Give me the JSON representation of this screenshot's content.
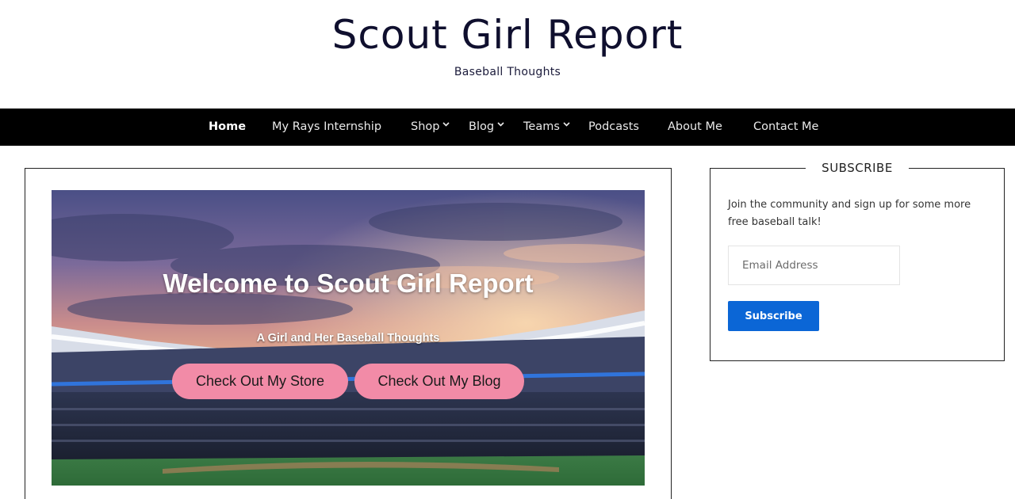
{
  "site": {
    "title": "Scout Girl Report",
    "tagline": "Baseball Thoughts"
  },
  "nav": {
    "items": [
      {
        "label": "Home",
        "active": true,
        "dropdown": false
      },
      {
        "label": "My Rays Internship",
        "active": false,
        "dropdown": false
      },
      {
        "label": "Shop",
        "active": false,
        "dropdown": true
      },
      {
        "label": "Blog",
        "active": false,
        "dropdown": true
      },
      {
        "label": "Teams",
        "active": false,
        "dropdown": true
      },
      {
        "label": "Podcasts",
        "active": false,
        "dropdown": false
      },
      {
        "label": "About Me",
        "active": false,
        "dropdown": false
      },
      {
        "label": "Contact Me",
        "active": false,
        "dropdown": false
      }
    ]
  },
  "hero": {
    "title": "Welcome to Scout Girl Report",
    "subtitle": "A Girl and Her Baseball Thoughts",
    "buttons": [
      {
        "label": "Check Out My Store"
      },
      {
        "label": "Check Out My Blog"
      }
    ]
  },
  "sidebar": {
    "heading": "SUBSCRIBE",
    "text": "Join the community and sign up for some more free baseball talk!",
    "email_placeholder": "Email Address",
    "email_value": "",
    "button_label": "Subscribe"
  },
  "colors": {
    "nav_background": "#000000",
    "hero_button": "#f28ba7",
    "subscribe_button": "#0b66d6",
    "title_text": "#0f0f2e"
  }
}
